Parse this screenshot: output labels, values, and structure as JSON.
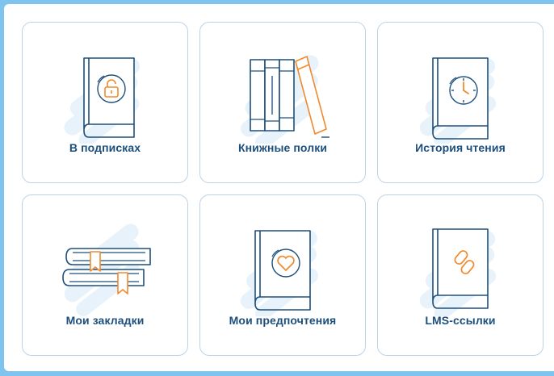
{
  "cards": [
    {
      "label": "В подписках",
      "icon": "book-lock-icon"
    },
    {
      "label": "Книжные полки",
      "icon": "bookshelf-icon"
    },
    {
      "label": "История чтения",
      "icon": "book-clock-icon"
    },
    {
      "label": "Мои закладки",
      "icon": "books-bookmarks-icon"
    },
    {
      "label": "Мои предпочтения",
      "icon": "book-heart-icon"
    },
    {
      "label": "LMS-ссылки",
      "icon": "book-link-icon"
    }
  ],
  "colors": {
    "stroke": "#1d4f7c",
    "accent": "#f08a2c",
    "blob": "#e7f2fb",
    "border": "#bcd3e6",
    "outer": "#7fc4ee"
  }
}
